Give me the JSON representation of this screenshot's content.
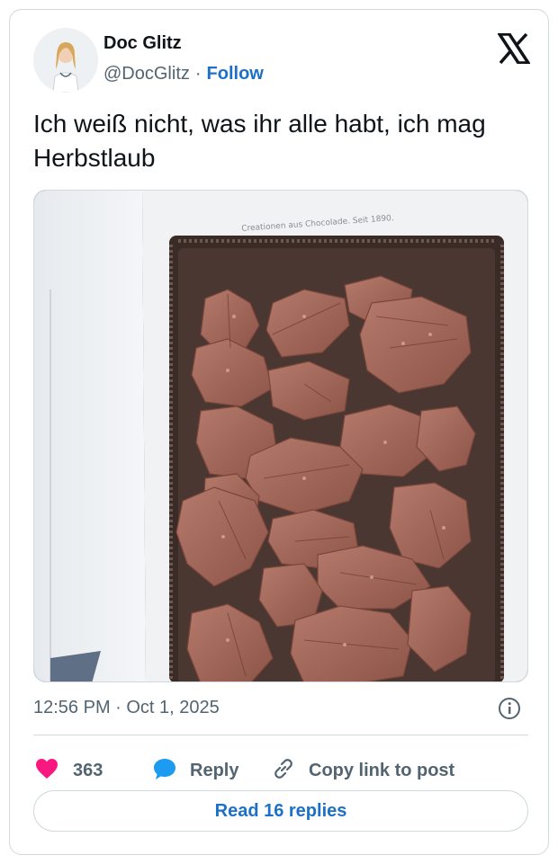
{
  "author": {
    "display_name": "Doc Glitz",
    "handle": "@DocGlitz",
    "separator": "·",
    "follow_label": "Follow"
  },
  "brand_icon": "x-logo-icon",
  "tweet": {
    "text": "Ich weiß nicht, was ihr alle habt, ich mag Herbstlaub",
    "image": {
      "box_lid_text": "Creationen aus Chocolade. Seit 1890."
    },
    "timestamp": "12:56 PM · Oct 1, 2025"
  },
  "actions": {
    "likes_count": "363",
    "reply_label": "Reply",
    "copy_link_label": "Copy link to post"
  },
  "read_replies_label": "Read 16 replies",
  "colors": {
    "link_blue": "#1d70c8",
    "like_pink": "#f91880",
    "reply_blue": "#1d9bf0",
    "muted_text": "#536471",
    "border": "#cfd9de"
  }
}
